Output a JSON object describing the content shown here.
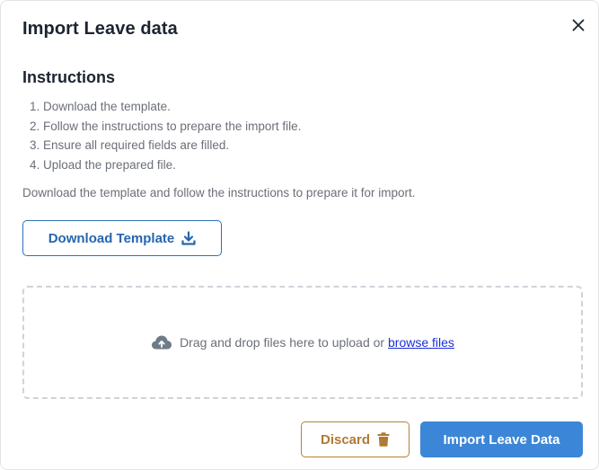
{
  "dialog": {
    "title": "Import Leave data",
    "close_icon": "close-icon"
  },
  "instructions": {
    "heading": "Instructions",
    "steps": [
      "1. Download the template.",
      "2. Follow the instructions to prepare the import file.",
      "3. Ensure all required fields are filled.",
      "4. Upload the prepared file."
    ],
    "help_text": "Download the template and follow the instructions to prepare it for import."
  },
  "download": {
    "label": "Download Template",
    "icon": "download-icon",
    "color": "#2566ae"
  },
  "dropzone": {
    "icon": "cloud-upload-icon",
    "text": "Drag and drop files here to upload or",
    "link_text": "browse files"
  },
  "footer": {
    "discard_label": "Discard",
    "discard_icon": "trash-icon",
    "discard_color": "#b07a34",
    "import_label": "Import Leave Data",
    "import_color": "#3b86d6"
  }
}
